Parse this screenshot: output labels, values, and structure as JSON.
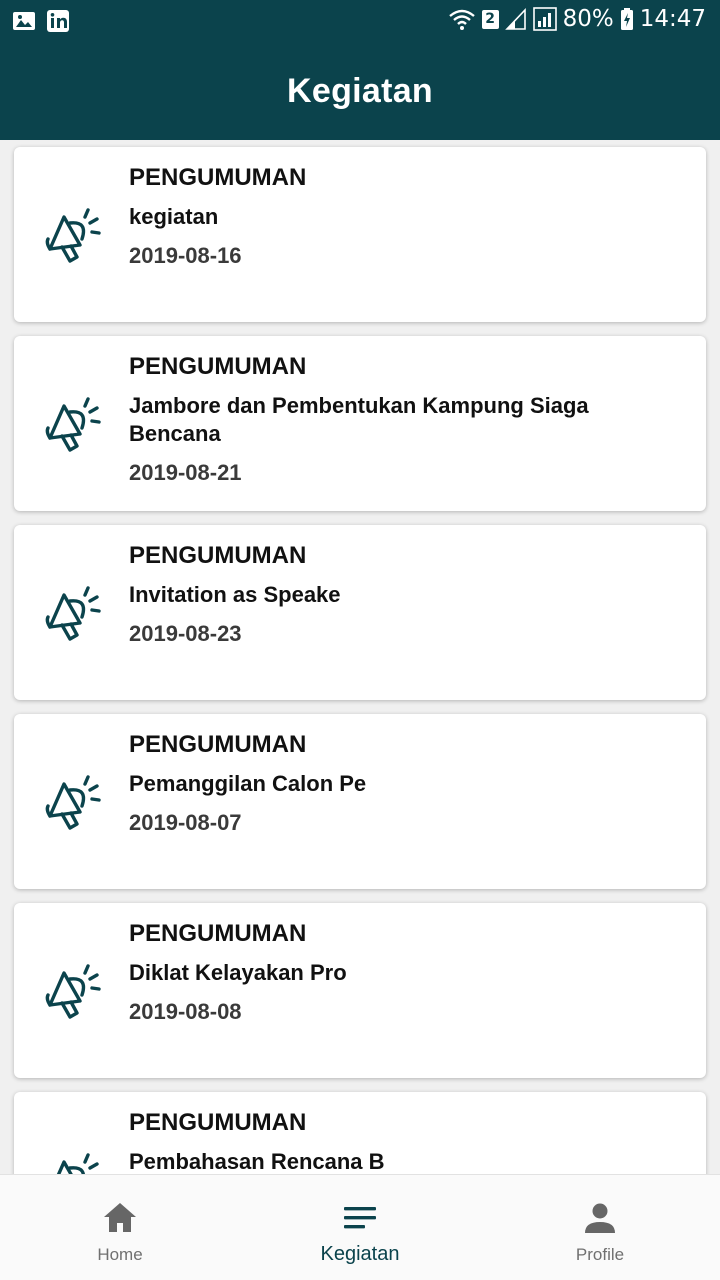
{
  "status_bar": {
    "sim_badge": "2",
    "battery": "80%",
    "time": "14:47"
  },
  "app_bar": {
    "title": "Kegiatan"
  },
  "cards": [
    {
      "type": "PENGUMUMAN",
      "title": "kegiatan",
      "date": "2019-08-16"
    },
    {
      "type": "PENGUMUMAN",
      "title": "Jambore dan Pembentukan Kampung Siaga Bencana",
      "date": "2019-08-21"
    },
    {
      "type": "PENGUMUMAN",
      "title": "Invitation as Speake",
      "date": "2019-08-23"
    },
    {
      "type": "PENGUMUMAN",
      "title": "Pemanggilan Calon Pe",
      "date": "2019-08-07"
    },
    {
      "type": "PENGUMUMAN",
      "title": "Diklat Kelayakan Pro",
      "date": "2019-08-08"
    },
    {
      "type": "PENGUMUMAN",
      "title": "Pembahasan Rencana B",
      "date": ""
    }
  ],
  "icons": {
    "card": "megaphone-icon",
    "home": "home-icon",
    "kegiatan": "menu-lines-icon",
    "profile": "person-icon"
  },
  "bottom_nav": {
    "home": "Home",
    "kegiatan": "Kegiatan",
    "profile": "Profile",
    "active": "kegiatan"
  },
  "colors": {
    "primary": "#0b434c",
    "inactive": "#707070"
  }
}
